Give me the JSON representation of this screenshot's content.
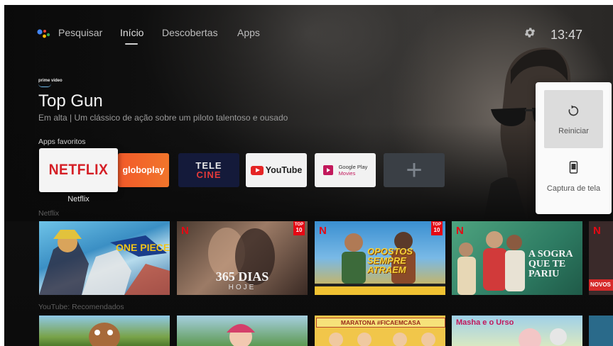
{
  "nav": {
    "search_label": "Pesquisar",
    "tabs": [
      {
        "label": "Início",
        "selected": true
      },
      {
        "label": "Descobertas",
        "selected": false
      },
      {
        "label": "Apps",
        "selected": false
      }
    ],
    "clock": "13:47"
  },
  "hero": {
    "provider": "prime video",
    "title": "Top Gun",
    "subtitle": "Em alta | Um clássico de ação sobre um piloto talentoso e ousado"
  },
  "favorites": {
    "label": "Apps favoritos",
    "apps": [
      {
        "name": "Netflix",
        "logo_text": "NETFLIX"
      },
      {
        "name": "globoplay",
        "logo_text": "globoplay"
      },
      {
        "name": "Telecine",
        "logo_line1": "TELE",
        "logo_line2": "CINE"
      },
      {
        "name": "YouTube",
        "logo_text": "YouTube"
      },
      {
        "name": "Google Play Movies",
        "logo_line1": "Google Play",
        "logo_line2": "Movies"
      },
      {
        "name": "Add app",
        "logo_text": "+"
      }
    ],
    "focused_caption": "Netflix"
  },
  "rows": {
    "netflix": {
      "label": "Netflix",
      "items": [
        {
          "title": "One Piece",
          "badge": ""
        },
        {
          "title": "365 DIAS",
          "subtitle": "HOJE",
          "badge": "N"
        },
        {
          "title": "OPOSTOS SEMPRE ATRAEM",
          "badge": "N"
        },
        {
          "title": "A SOGRA QUE TE PARIU",
          "badge": "N"
        },
        {
          "title": "NOVOS",
          "badge": "N"
        }
      ],
      "top10_label_line1": "TOP",
      "top10_label_line2": "10"
    },
    "youtube": {
      "label": "YouTube: Recomendados",
      "items": [
        {
          "title": ""
        },
        {
          "title": ""
        },
        {
          "title": "MARATONA #FICAEMCASA"
        },
        {
          "title": "Masha e o Urso"
        }
      ]
    }
  },
  "popup": {
    "restart_label": "Reiniciar",
    "screenshot_label": "Captura de tela"
  },
  "colors": {
    "netflix_red": "#e50914",
    "popup_bg": "#fafafa",
    "focus_bg": "#dcdcdc"
  }
}
